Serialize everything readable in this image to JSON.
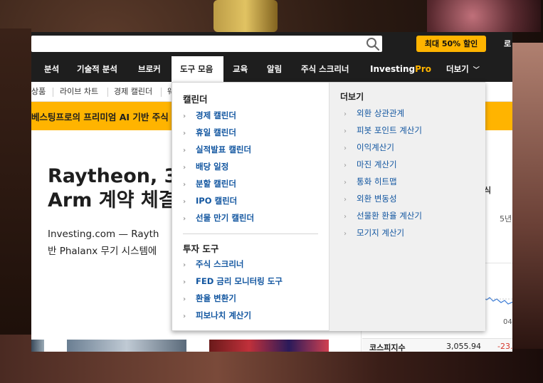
{
  "header": {
    "search_placeholder": "",
    "promo_label": "최대 50% 할인",
    "top_right_text": "로"
  },
  "nav": {
    "items": [
      {
        "label": "분석"
      },
      {
        "label": "기술적 분석"
      },
      {
        "label": "브로커"
      },
      {
        "label": "도구 모음"
      },
      {
        "label": "교육"
      },
      {
        "label": "알림"
      },
      {
        "label": "주식 스크리너"
      },
      {
        "label": "Investing"
      },
      {
        "label": "Pro"
      },
      {
        "label": "더보기"
      }
    ]
  },
  "subnav": {
    "items": [
      {
        "label": "상품"
      },
      {
        "label": "라이브 차트"
      },
      {
        "label": "경제 캘린더"
      },
      {
        "label": "웨"
      }
    ]
  },
  "banner": {
    "text": "베스팅프로의 프리미엄 AI 기반 주식"
  },
  "article": {
    "headline_line1": "Raytheon, 3",
    "headline_line2": "Arm 계약 체결",
    "summary_line1": "Investing.com — Rayth",
    "summary_line2": "반 Phalanx 무기 시스템에"
  },
  "right_panel": {
    "text1": "식",
    "text2": "5년",
    "text3": "04"
  },
  "index_row": {
    "name": "코스피지수",
    "value": "3,055.94",
    "change": "-23."
  },
  "dropdown": {
    "calendar": {
      "heading": "캘린더",
      "items": [
        {
          "label": "경제 캘린더"
        },
        {
          "label": "휴일 캘린더"
        },
        {
          "label": "실적발표 캘린더"
        },
        {
          "label": "배당 일정"
        },
        {
          "label": "분할 캘린더"
        },
        {
          "label": "IPO 캘린더"
        },
        {
          "label": "선물 만기 캘린더"
        }
      ]
    },
    "invest_tools": {
      "heading": "투자 도구",
      "items": [
        {
          "label": "주식 스크리너"
        },
        {
          "label": "FED 금리 모니터링 도구"
        },
        {
          "label": "환율 변환기"
        },
        {
          "label": "피보나치 계산기"
        }
      ]
    },
    "more": {
      "heading": "더보기",
      "items": [
        {
          "label": "외환 상관관계"
        },
        {
          "label": "피봇 포인트 계산기"
        },
        {
          "label": "이익계산기"
        },
        {
          "label": "마진 계산기"
        },
        {
          "label": "통화 히트맵"
        },
        {
          "label": "외환 변동성"
        },
        {
          "label": "선물환 환율 계산기"
        },
        {
          "label": "모기지 계산기"
        }
      ]
    }
  },
  "colors": {
    "accent": "#ffb400",
    "nav_bg": "#1e1e1e",
    "link": "#1256a0",
    "negative": "#d5362b"
  }
}
